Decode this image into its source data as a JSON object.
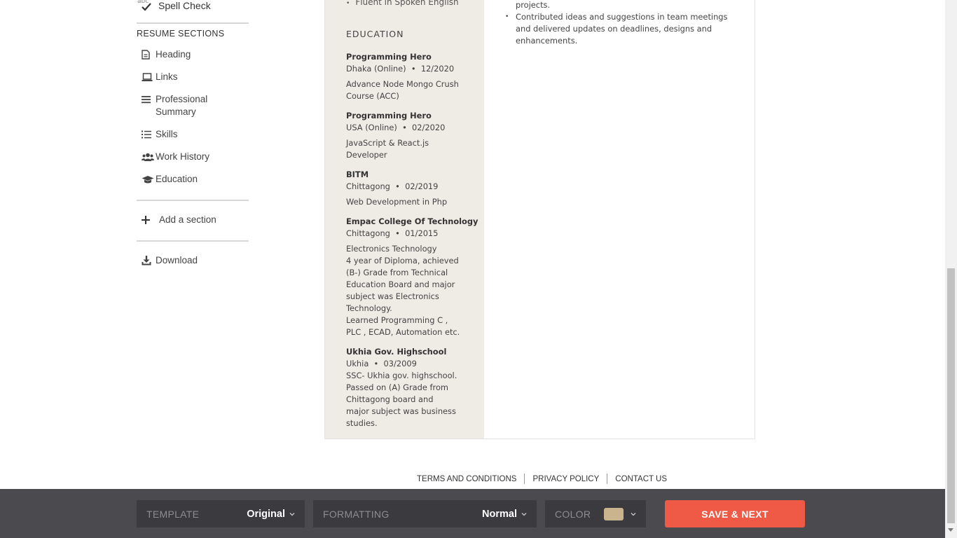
{
  "sidebar": {
    "spell_check": {
      "abc": "abc",
      "label": "Spell Check"
    },
    "section_title": "RESUME SECTIONS",
    "items": [
      {
        "label": "Heading",
        "icon": "document-icon"
      },
      {
        "label": "Links",
        "icon": "laptop-icon"
      },
      {
        "label": "Professional Summary",
        "icon": "lines-icon"
      },
      {
        "label": "Skills",
        "icon": "list-icon"
      },
      {
        "label": "Work History",
        "icon": "users-icon"
      },
      {
        "label": "Education",
        "icon": "graduation-cap-icon"
      }
    ],
    "add_section": "Add a section",
    "download": "Download"
  },
  "resume": {
    "left_prev_item": "Fluent in Spoken English",
    "education_heading": "EDUCATION",
    "education": [
      {
        "school": "Programming Hero",
        "location": "Dhaka (Online)",
        "date": "12/2020",
        "description": [
          "Advance Node Mongo Crush Course (ACC)"
        ]
      },
      {
        "school": "Programming Hero",
        "location": "USA (Online)",
        "date": "02/2020",
        "description": [
          "JavaScript & React.js Developer"
        ]
      },
      {
        "school": "BITM",
        "location": "Chittagong",
        "date": "02/2019",
        "description": [
          "Web Development in Php"
        ]
      },
      {
        "school": "Empac College Of Technology",
        "location": "Chittagong",
        "date": "01/2015",
        "description": [
          "Electronics Technology",
          "4 year of Diploma, achieved (B-) Grade from Technical Education Board and major subject was Electronics Technology.",
          "Learned Programming C , PLC , ECAD, Automation etc."
        ]
      },
      {
        "school": "Ukhia Gov. Highschool",
        "location": "Ukhia",
        "date": "03/2009",
        "description": [
          "SSC- Ukhia gov. highschool. Passed on (A) Grade from Chittagong board and major subject was business studies."
        ]
      }
    ],
    "right_prev_line": "projects.",
    "right_bullets": [
      "Contributed ideas and suggestions in team meetings and delivered updates on deadlines, designs and enhancements."
    ]
  },
  "footer": {
    "links": [
      "TERMS AND CONDITIONS",
      "PRIVACY POLICY",
      "CONTACT US"
    ]
  },
  "toolbar": {
    "template_label": "TEMPLATE",
    "template_value": "Original",
    "formatting_label": "FORMATTING",
    "formatting_value": "Normal",
    "color_label": "COLOR",
    "color_value": "#c9b48d",
    "save_label": "SAVE & NEXT",
    "save_color": "#ef5a46"
  }
}
